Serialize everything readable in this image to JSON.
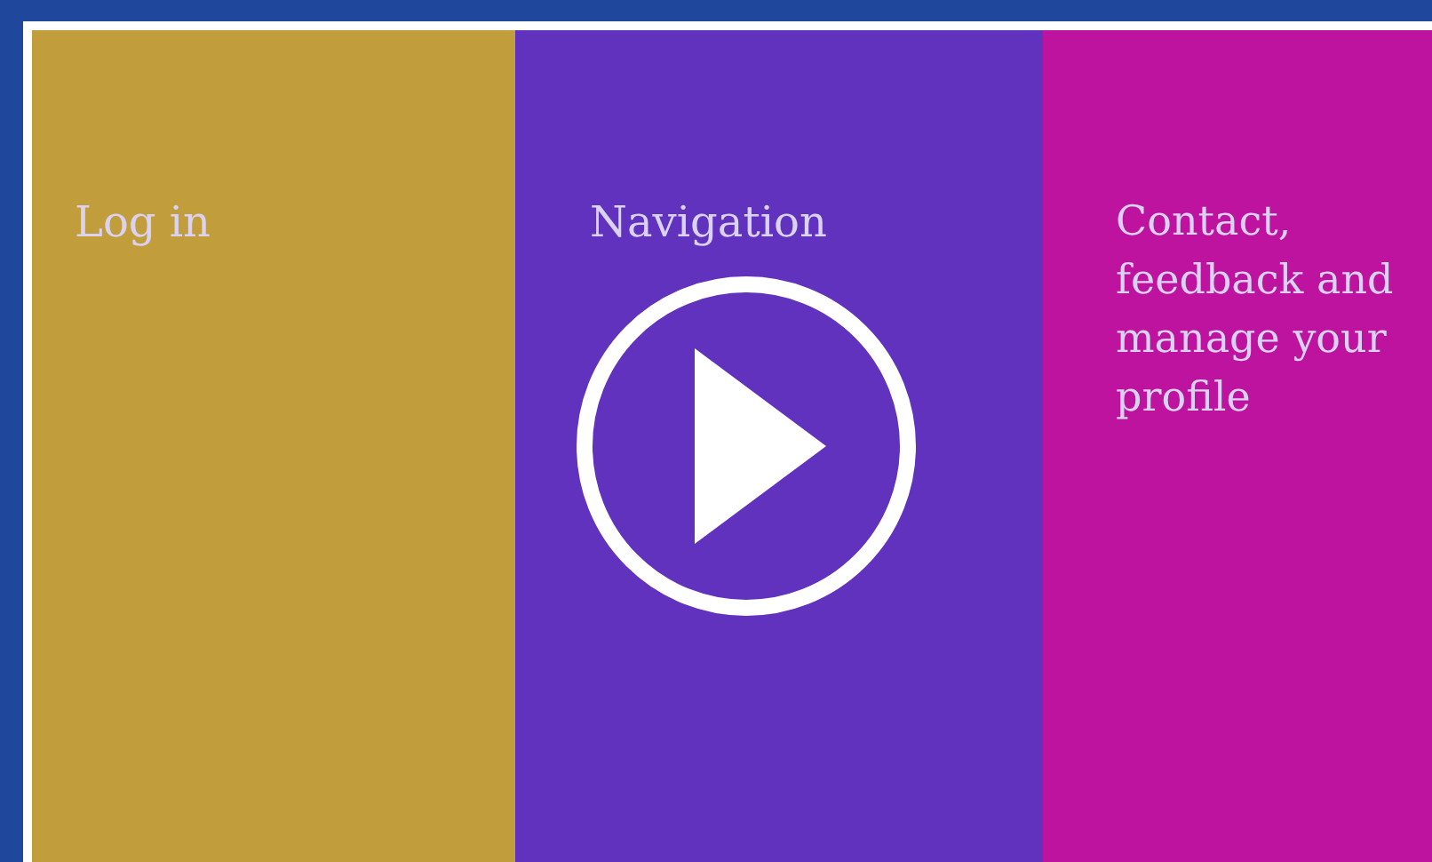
{
  "panels": [
    {
      "label": "Log in",
      "color": "#c29d3c"
    },
    {
      "label": "Navigation",
      "color": "#6032be"
    },
    {
      "label": "Contact, feedback and manage your profile",
      "color": "#be139f"
    }
  ],
  "play_button": {
    "kind": "play"
  }
}
